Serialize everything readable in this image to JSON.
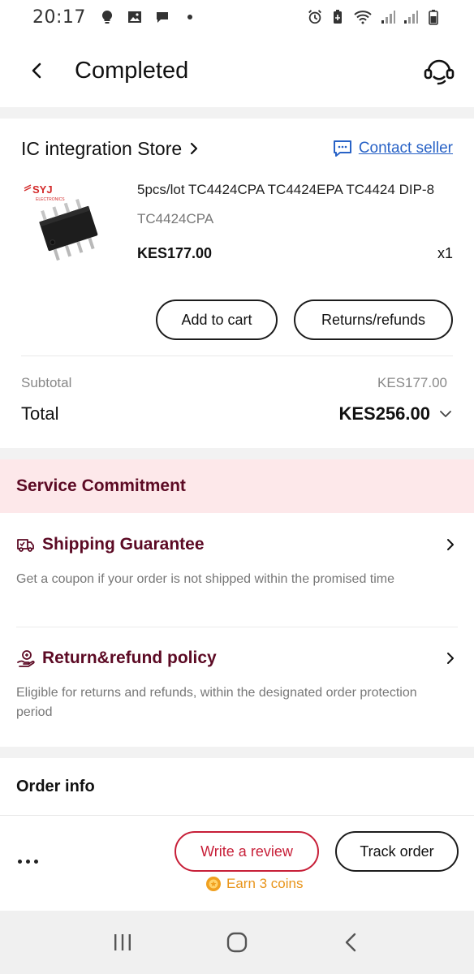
{
  "status_bar": {
    "time": "20:17",
    "left_icons": [
      "bulb-icon",
      "image-icon",
      "chat-bubble-icon",
      "dot-icon"
    ],
    "right_icons": [
      "alarm-icon",
      "battery-saver-icon",
      "wifi-icon",
      "signal-icon",
      "signal-icon",
      "battery-icon"
    ]
  },
  "header": {
    "title": "Completed",
    "back_icon": "chevron-left-icon",
    "support_icon": "headset-icon"
  },
  "order": {
    "store_name": "IC integration Store",
    "contact_label": "Contact seller",
    "product": {
      "title": "5pcs/lot TC4424CPA TC4424EPA TC4424 DIP-8",
      "variant": "TC4424CPA",
      "price": "KES177.00",
      "quantity": "x1",
      "thumb_brand": "SYJ",
      "thumb_brand_sub": "ELECTRONICS"
    },
    "buttons": {
      "add_to_cart": "Add to cart",
      "returns": "Returns/refunds"
    },
    "subtotal_label": "Subtotal",
    "subtotal_value": "KES177.00",
    "total_label": "Total",
    "total_value": "KES256.00"
  },
  "service": {
    "title": "Service Commitment",
    "items": [
      {
        "icon": "delivery-truck-icon",
        "title": "Shipping Guarantee",
        "desc": "Get a coupon if your order is not shipped within the promised time"
      },
      {
        "icon": "refund-hand-icon",
        "title": "Return&refund policy",
        "desc": "Eligible for returns and refunds, within the designated order protection period"
      }
    ]
  },
  "order_info": {
    "title": "Order info"
  },
  "actions": {
    "more_label": "...",
    "review": "Write a review",
    "track": "Track order",
    "coins": "Earn 3 coins"
  },
  "colors": {
    "accent": "#c71f38",
    "service_bg": "#fde8ea",
    "service_text": "#5c0a24",
    "link": "#2862c6",
    "coins": "#e8941a"
  }
}
